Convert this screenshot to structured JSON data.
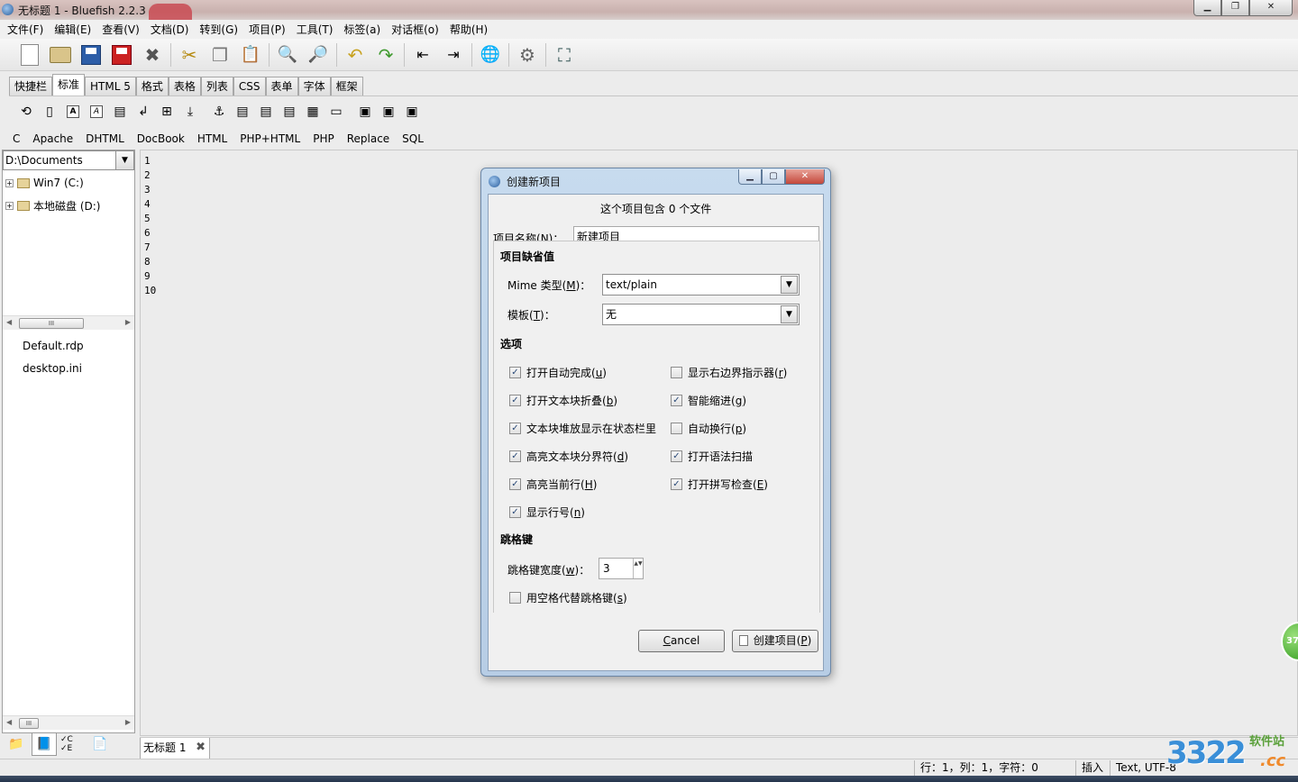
{
  "window": {
    "title": "无标题 1 - Bluefish 2.2.3",
    "min_glyph": "▁",
    "max_glyph": "❐",
    "close_glyph": "✕"
  },
  "menu": [
    "文件(F)",
    "编辑(E)",
    "查看(V)",
    "文档(D)",
    "转到(G)",
    "项目(P)",
    "工具(T)",
    "标签(a)",
    "对话框(o)",
    "帮助(H)"
  ],
  "toolbar_icons": [
    "new-file-icon",
    "open-folder-icon",
    "save-icon",
    "save-as-icon",
    "close-file-icon",
    "cut-icon",
    "copy-icon",
    "paste-icon",
    "find-icon",
    "replace-icon",
    "undo-icon",
    "redo-icon",
    "unindent-icon",
    "indent-icon",
    "preview-globe-icon",
    "preferences-icon",
    "fullscreen-icon"
  ],
  "toolbar_glyphs": [
    "",
    "",
    "",
    "",
    "✖",
    "✂",
    "❐",
    "📋",
    "🔍",
    "🔎",
    "↶",
    "↷",
    "⇤",
    "⇥",
    "🌐",
    "⚙",
    "⛶"
  ],
  "html_tabs": [
    "快捷栏",
    "标准",
    "HTML 5",
    "格式",
    "表格",
    "列表",
    "CSS",
    "表单",
    "字体",
    "框架"
  ],
  "active_tab_index": 1,
  "html_toolbar_glyphs": [
    "⟲",
    "▯",
    "A",
    "A",
    "▤",
    "↲",
    "⊞",
    "⤓",
    "⚓",
    "▤",
    "▤",
    "▤",
    "▦",
    "▭",
    "▣",
    "▣",
    "▣"
  ],
  "languages": [
    "C",
    "Apache",
    "DHTML",
    "DocBook",
    "HTML",
    "PHP+HTML",
    "PHP",
    "Replace",
    "SQL"
  ],
  "sidebar": {
    "path": "D:\\Documents",
    "dropdown_glyph": "▼",
    "tree": [
      {
        "label": "Win7 (C:)",
        "expander": "+"
      },
      {
        "label": "本地磁盘 (D:)",
        "expander": "+"
      }
    ],
    "files": [
      "Default.rdp",
      "desktop.ini"
    ],
    "scroll_left": "◀",
    "scroll_right": "▶",
    "scroll_thumb": "III",
    "bottom_tabs": [
      "📁",
      "📘",
      "✓C ✓E",
      "📄"
    ]
  },
  "editor": {
    "line_numbers": [
      "1",
      "2",
      "3",
      "4",
      "5",
      "6",
      "7",
      "8",
      "9",
      "10"
    ]
  },
  "doc_tab": {
    "label": "无标题 1",
    "close_glyph": "✖"
  },
  "statusbar": {
    "position": "行：1，列：1，字符：0",
    "mode": "插入",
    "encoding": "Text, UTF-8"
  },
  "dialog": {
    "title": "创建新项目",
    "info": "这个项目包含 0 个文件",
    "name_label": "项目名称(",
    "name_mnemonic": "N",
    "name_label_end": ")：",
    "name_value": "新建项目",
    "defaults_heading": "项目缺省值",
    "mime_label": "Mime 类型(",
    "mime_mnemonic": "M",
    "mime_label_end": ")：",
    "mime_value": "text/plain",
    "template_label": "模板(",
    "template_mnemonic": "T",
    "template_label_end": ")：",
    "template_value": "无",
    "options_heading": "选项",
    "options": [
      {
        "label": "打开自动完成(",
        "key": "u",
        "end": ")",
        "checked": true
      },
      {
        "label": "显示右边界指示器(",
        "key": "r",
        "end": ")",
        "checked": false
      },
      {
        "label": "打开文本块折叠(",
        "key": "b",
        "end": ")",
        "checked": true
      },
      {
        "label": "智能缩进(",
        "key": "g",
        "end": ")",
        "checked": true
      },
      {
        "label": "文本块堆放显示在状态栏里",
        "key": "",
        "end": "",
        "checked": true
      },
      {
        "label": "自动换行(",
        "key": "p",
        "end": ")",
        "checked": false
      },
      {
        "label": "高亮文本块分界符(",
        "key": "d",
        "end": ")",
        "checked": true
      },
      {
        "label": "打开语法扫描",
        "key": "",
        "end": "",
        "checked": true
      },
      {
        "label": "高亮当前行(",
        "key": "H",
        "end": ")",
        "checked": true
      },
      {
        "label": "打开拼写检查(",
        "key": "E",
        "end": ")",
        "checked": true
      },
      {
        "label": "显示行号(",
        "key": "n",
        "end": ")",
        "checked": true
      }
    ],
    "tab_heading": "跳格键",
    "tab_width_label": "跳格键宽度(",
    "tab_width_mnemonic": "w",
    "tab_width_label_end": ")：",
    "tab_width_value": "3",
    "spaces_label": "用空格代替跳格键(",
    "spaces_mnemonic": "s",
    "spaces_label_end": ")",
    "spaces_checked": false,
    "cancel_mnemonic": "C",
    "cancel_rest": "ancel",
    "create_label": "创建项目(",
    "create_mnemonic": "P",
    "create_label_end": ")",
    "check_glyph": "✓",
    "min_glyph": "▁",
    "max_glyph": "▢",
    "close_glyph": "✕",
    "spin_glyph": "▲▼",
    "dropdown_glyph": "▼"
  },
  "watermark": {
    "digits": "3322",
    "site": "软件站",
    "tld": ".cc",
    "badge": "37"
  }
}
